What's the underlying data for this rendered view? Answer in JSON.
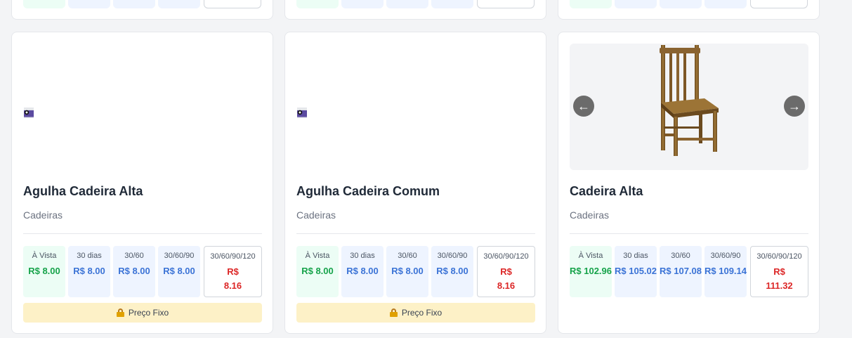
{
  "previous_row": [
    {
      "cells": [
        "green",
        "blue",
        "blue",
        "blue",
        "white"
      ]
    },
    {
      "cells": [
        "green",
        "blue",
        "blue",
        "blue",
        "white"
      ]
    },
    {
      "cells": [
        "green",
        "blue",
        "blue",
        "blue",
        "white"
      ]
    }
  ],
  "products": [
    {
      "name": "Agulha Cadeira Alta",
      "category": "Cadeiras",
      "image": "broken-image-icon",
      "prices": [
        {
          "label": "À Vista",
          "value": "R$ 8.00",
          "style": "green"
        },
        {
          "label": "30 dias",
          "value": "R$ 8.00",
          "style": "blue"
        },
        {
          "label": "30/60",
          "value": "R$ 8.00",
          "style": "blue"
        },
        {
          "label": "30/60/90",
          "value": "R$ 8.00",
          "style": "blue"
        },
        {
          "label": "30/60/90/120",
          "value": "R$ 8.16",
          "style": "white"
        }
      ],
      "badge": "Preço Fixo"
    },
    {
      "name": "Agulha Cadeira Comum",
      "category": "Cadeiras",
      "image": "broken-image-icon",
      "prices": [
        {
          "label": "À Vista",
          "value": "R$ 8.00",
          "style": "green"
        },
        {
          "label": "30 dias",
          "value": "R$ 8.00",
          "style": "blue"
        },
        {
          "label": "30/60",
          "value": "R$ 8.00",
          "style": "blue"
        },
        {
          "label": "30/60/90",
          "value": "R$ 8.00",
          "style": "blue"
        },
        {
          "label": "30/60/90/120",
          "value": "R$ 8.16",
          "style": "white"
        }
      ],
      "badge": "Preço Fixo"
    },
    {
      "name": "Cadeira Alta",
      "category": "Cadeiras",
      "image": "wooden-chair-image",
      "carousel": {
        "prev": "←",
        "next": "→"
      },
      "prices": [
        {
          "label": "À Vista",
          "value": "R$ 102.96",
          "style": "green"
        },
        {
          "label": "30 dias",
          "value": "R$ 105.02",
          "style": "blue"
        },
        {
          "label": "30/60",
          "value": "R$ 107.08",
          "style": "blue"
        },
        {
          "label": "30/60/90",
          "value": "R$ 109.14",
          "style": "blue"
        },
        {
          "label": "30/60/90/120",
          "value": "R$ 111.32",
          "style": "white"
        }
      ]
    }
  ],
  "colors": {
    "green_value": "#16a34a",
    "blue_value": "#3b73d6",
    "red_value": "#dc2626",
    "badge_bg": "#fdf1c7"
  }
}
